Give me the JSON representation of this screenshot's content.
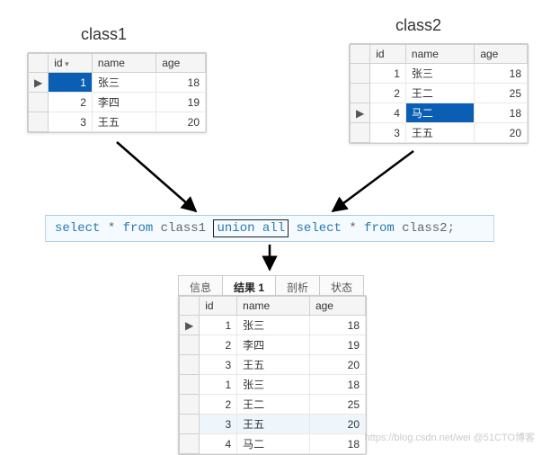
{
  "labels": {
    "class1": "class1",
    "class2": "class2"
  },
  "class1": {
    "headers": {
      "id": "id",
      "name": "name",
      "age": "age"
    },
    "rows": [
      {
        "id": 1,
        "name": "张三",
        "age": 18,
        "marker": "▶",
        "selected": true
      },
      {
        "id": 2,
        "name": "李四",
        "age": 19
      },
      {
        "id": 3,
        "name": "王五",
        "age": 20
      }
    ]
  },
  "class2": {
    "headers": {
      "id": "id",
      "name": "name",
      "age": "age"
    },
    "rows": [
      {
        "id": 1,
        "name": "张三",
        "age": 18
      },
      {
        "id": 2,
        "name": "王二",
        "age": 25
      },
      {
        "id": 4,
        "name": "马二",
        "age": 18,
        "marker": "▶",
        "selected": true
      },
      {
        "id": 3,
        "name": "王五",
        "age": 20
      }
    ]
  },
  "sql": {
    "p1": "select",
    "p2": "*",
    "p3": "from",
    "p4": "class1",
    "p5": "union all",
    "p6": "select",
    "p7": "*",
    "p8": "from",
    "p9": "class2;"
  },
  "tabs": {
    "t1": "信息",
    "t2": "结果 1",
    "t3": "剖析",
    "t4": "状态",
    "active": 1
  },
  "result": {
    "headers": {
      "id": "id",
      "name": "name",
      "age": "age"
    },
    "rows": [
      {
        "id": 1,
        "name": "张三",
        "age": 18,
        "marker": "▶"
      },
      {
        "id": 2,
        "name": "李四",
        "age": 19
      },
      {
        "id": 3,
        "name": "王五",
        "age": 20
      },
      {
        "id": 1,
        "name": "张三",
        "age": 18
      },
      {
        "id": 2,
        "name": "王二",
        "age": 25
      },
      {
        "id": 3,
        "name": "王五",
        "age": 20,
        "hilite": true
      },
      {
        "id": 4,
        "name": "马二",
        "age": 18
      }
    ]
  },
  "watermark": "https://blog.csdn.net/wei @51CTO博客"
}
